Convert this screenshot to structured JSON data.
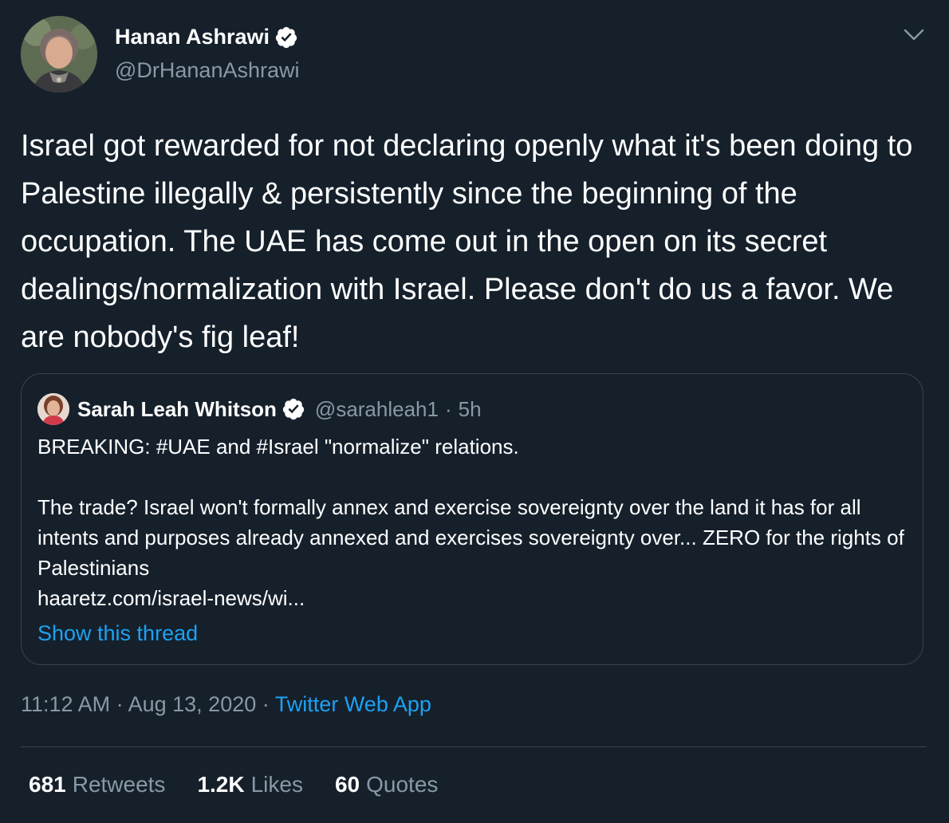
{
  "author": {
    "name": "Hanan Ashrawi",
    "handle": "@DrHananAshrawi",
    "verified_icon": "verified-badge-icon",
    "avatar": "avatar-photo"
  },
  "tweet": {
    "text": "Israel got rewarded for not declaring openly what it's been doing to Palestine illegally & persistently since the beginning of the occupation. The UAE has come out in the open on its secret dealings/normalization with Israel. Please don't do us a favor. We are nobody's fig leaf!"
  },
  "quote": {
    "name": "Sarah Leah Whitson",
    "handle": "@sarahleah1",
    "separator": "·",
    "time": "5h",
    "text": "BREAKING: #UAE and #Israel \"normalize\" relations.\n\nThe trade? Israel won't formally annex and exercise sovereignty over the land it has for all intents and purposes already annexed and exercises sovereignty over... ZERO for the rights of Palestinians\nhaaretz.com/israel-news/wi...",
    "show_thread": "Show this thread"
  },
  "meta": {
    "time": "11:12 AM",
    "sep1": "·",
    "date": "Aug 13, 2020",
    "sep2": "·",
    "source": "Twitter Web App"
  },
  "stats": {
    "retweets_count": "681",
    "retweets_label": "Retweets",
    "likes_count": "1.2K",
    "likes_label": "Likes",
    "quotes_count": "60",
    "quotes_label": "Quotes"
  },
  "colors": {
    "background": "#15202b",
    "accent": "#1da1f2",
    "muted": "#8899a6",
    "border": "#38444d"
  }
}
